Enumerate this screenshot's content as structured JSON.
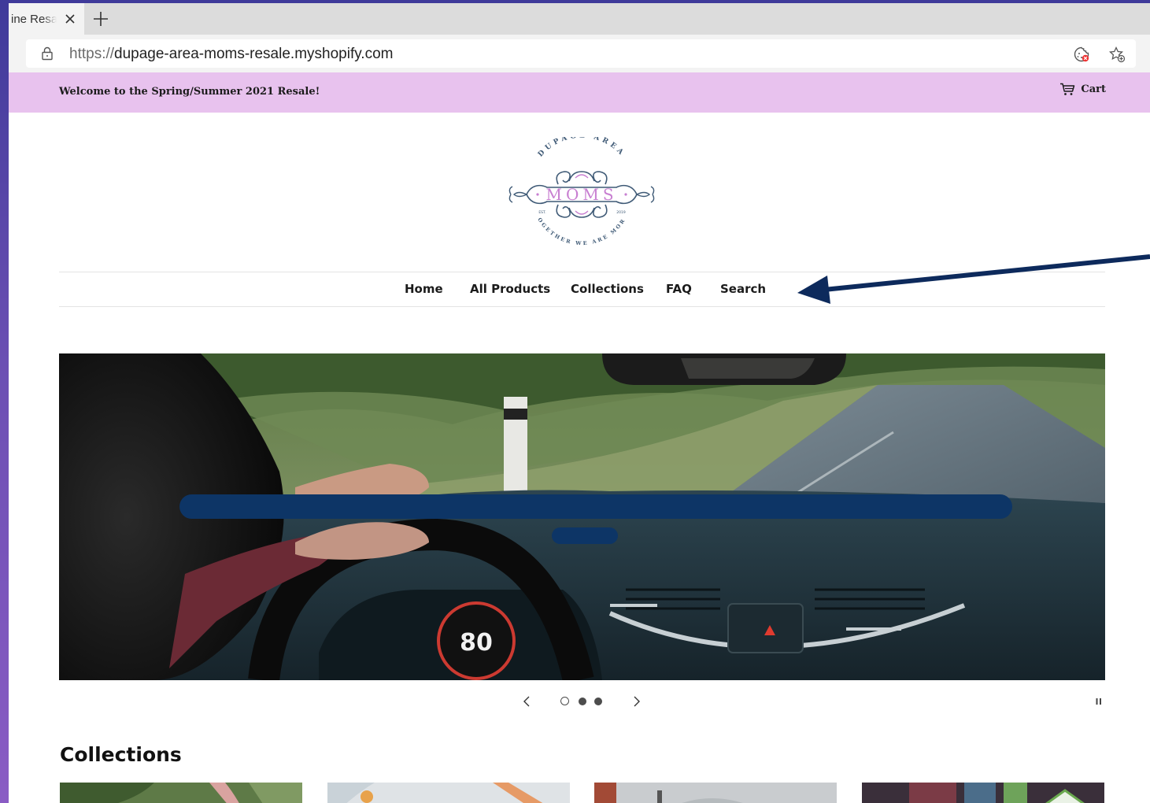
{
  "browser": {
    "tab_title": "ine Resa",
    "url_scheme": "https://",
    "url_host": "dupage-area-moms-resale.myshopify.com"
  },
  "announcement": {
    "text": "Welcome to the Spring/Summer 2021 Resale!",
    "cart_label": "Cart"
  },
  "logo": {
    "top_text": "DUPAGE AREA",
    "center_text": "MOMS",
    "est_text": "EST.",
    "year_text": "2019",
    "bottom_text": "TOGETHER WE ARE MORE"
  },
  "nav": {
    "items": [
      {
        "label": "Home"
      },
      {
        "label": "All Products"
      },
      {
        "label": "Collections"
      },
      {
        "label": "FAQ"
      },
      {
        "label": "Search"
      }
    ]
  },
  "hero": {
    "speedometer_value": "80"
  },
  "collections": {
    "title": "Collections"
  },
  "colors": {
    "announcement_bg": "#e8c2ee",
    "redaction": "#0d3566",
    "arrow": "#0d2a5c",
    "logo_accent": "#c87fd1",
    "logo_line": "#3f5a76"
  }
}
